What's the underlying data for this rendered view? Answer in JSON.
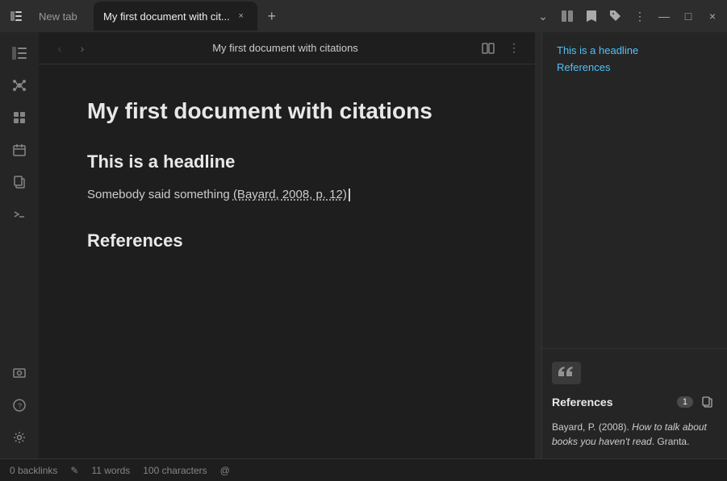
{
  "tabs": {
    "inactive": {
      "label": "New tab"
    },
    "active": {
      "label": "My first document with cit..."
    },
    "close_label": "×",
    "new_tab_label": "+"
  },
  "tab_bar_actions": {
    "dropdown_icon": "⌄",
    "sidebar_icon": "▣",
    "link1_icon": "🔗",
    "link2_icon": "🔗",
    "tag_icon": "◇",
    "more_icon": "⋮",
    "minimize_icon": "—",
    "maximize_icon": "□",
    "close_icon": "×"
  },
  "sidebar": {
    "top_icons": [
      {
        "name": "sidebar-toggle",
        "icon": "☰"
      },
      {
        "name": "connections",
        "icon": "⊙"
      },
      {
        "name": "grid",
        "icon": "⊞"
      },
      {
        "name": "calendar",
        "icon": "▦"
      },
      {
        "name": "copy",
        "icon": "⧉"
      },
      {
        "name": "terminal",
        "icon": ">"
      }
    ],
    "bottom_icons": [
      {
        "name": "screenshot",
        "icon": "⊡"
      },
      {
        "name": "help",
        "icon": "?"
      },
      {
        "name": "settings",
        "icon": "⚙"
      }
    ]
  },
  "topbar": {
    "back_label": "‹",
    "forward_label": "›",
    "title": "My first document with citations",
    "reader_icon": "⊟",
    "more_icon": "⋮"
  },
  "document": {
    "main_title": "My first document with citations",
    "headline": "This is a headline",
    "paragraph": "Somebody said something ",
    "citation": "(Bayard, 2008, p. 12)",
    "ref_heading": "References"
  },
  "right_sidebar": {
    "toc": [
      {
        "label": "This is a headline"
      },
      {
        "label": "References"
      }
    ],
    "quote_icon": "❝❞",
    "references_label": "References",
    "references_count": "1",
    "copy_icon": "⧉",
    "ref_entry": {
      "author": "Bayard, P. (2008). ",
      "title_italic": "How to talk about books you haven't read",
      "publisher": ". Granta."
    }
  },
  "status_bar": {
    "backlinks": "0 backlinks",
    "edit_icon": "✎",
    "words": "11 words",
    "chars": "100 characters",
    "at_icon": "@"
  }
}
